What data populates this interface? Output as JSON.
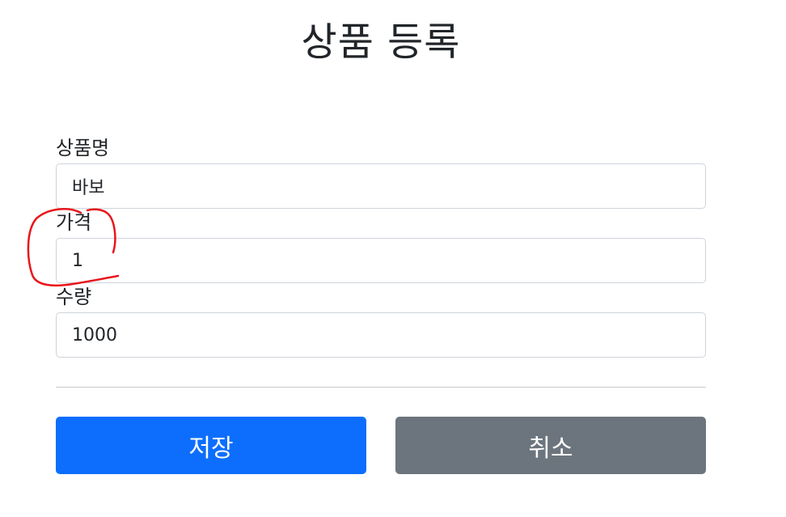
{
  "page": {
    "title": "상품 등록"
  },
  "form": {
    "fields": [
      {
        "label": "상품명",
        "value": "바보"
      },
      {
        "label": "가격",
        "value": "1"
      },
      {
        "label": "수량",
        "value": "1000"
      }
    ]
  },
  "buttons": {
    "save_label": "저장",
    "cancel_label": "취소"
  },
  "colors": {
    "primary": "#0d6efd",
    "secondary": "#6c757d",
    "annotation": "#e8151b"
  }
}
